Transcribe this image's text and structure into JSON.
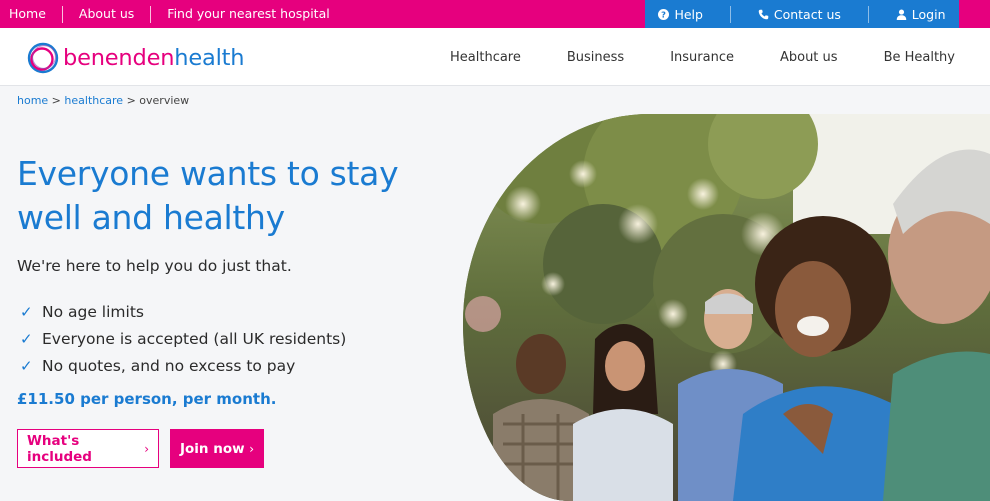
{
  "topbar": {
    "links": [
      "Home",
      "About us",
      "Find your nearest hospital"
    ],
    "help_label": "Help",
    "contact_label": "Contact us",
    "login_label": "Login"
  },
  "header": {
    "logo_part1": "benenden",
    "logo_part2": "health",
    "nav": [
      "Healthcare",
      "Business",
      "Insurance",
      "About us",
      "Be Healthy"
    ]
  },
  "breadcrumb": {
    "home": "home",
    "sep1": " > ",
    "healthcare": "healthcare",
    "sep2": " > ",
    "current": "overview"
  },
  "hero": {
    "title": "Everyone wants to stay well and healthy",
    "subtitle": "We're here to help you do just that.",
    "checklist": [
      "No age limits",
      "Everyone is accepted (all UK residents)",
      "No quotes, and no excess to pay"
    ],
    "price": "£11.50 per person, per month.",
    "btn_included": "What's included",
    "btn_join": "Join now"
  },
  "colors": {
    "brand_pink": "#e6007e",
    "brand_blue": "#1a7bd1"
  },
  "icons": {
    "help": "question-circle-icon",
    "contact": "phone-icon",
    "login": "user-icon",
    "check": "checkmark-icon",
    "chevron": "chevron-right-icon"
  }
}
